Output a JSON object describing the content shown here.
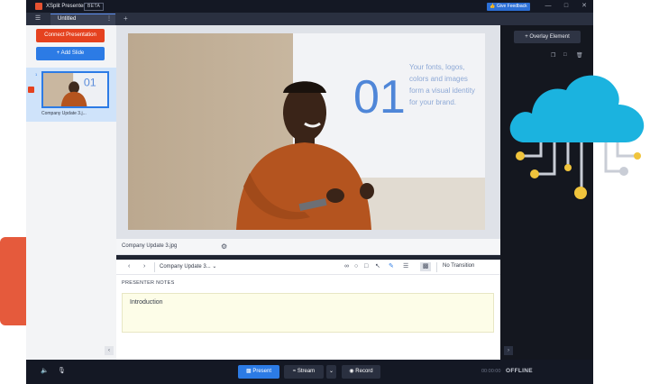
{
  "app": {
    "title": "XSplit Presenter",
    "beta_badge": "BETA",
    "feedback_button": "Give Feedback",
    "tab_label": "Untitled",
    "colors": {
      "brand": "#e5421f",
      "accent": "#2c7be5",
      "window_bg": "#1f2431",
      "notes_bg": "#fdfde8"
    }
  },
  "slides_panel": {
    "connect_button": "Connect Presentation",
    "add_slide_button": "+ Add Slide",
    "items": [
      {
        "number": "1",
        "caption": "Company Update 3.j..."
      }
    ]
  },
  "preview": {
    "image_label": "Company Update 3.jpg",
    "slide_text_big": "01",
    "slide_text_body": "Your fonts, logos, colors and images form a visual identity for your brand."
  },
  "toolbar": {
    "file_select": "Company Update 3...",
    "transition_select": "No Transition"
  },
  "notes": {
    "label": "PRESENTER NOTES",
    "text": "Introduction"
  },
  "right_panel": {
    "overlay_button": "+ Overlay Element"
  },
  "bottom_bar": {
    "present_label": "Present",
    "stream_label": "Stream",
    "record_label": "Record",
    "timer": "00:00:00",
    "status": "OFFLINE"
  },
  "icons": [
    "hamburger-icon",
    "kebab-icon",
    "plus-icon",
    "gear-icon",
    "chevron-left-icon",
    "chevron-right-icon",
    "lasso-icon",
    "circle-icon",
    "square-icon",
    "pointer-icon",
    "highlighter-icon",
    "line-weight-icon",
    "screen-icon",
    "copy-icon",
    "duplicate-icon",
    "trash-icon",
    "speaker-icon",
    "microphone-icon",
    "monitor-icon",
    "wifi-icon",
    "record-dot-icon",
    "cloud-icon",
    "play-icon"
  ]
}
